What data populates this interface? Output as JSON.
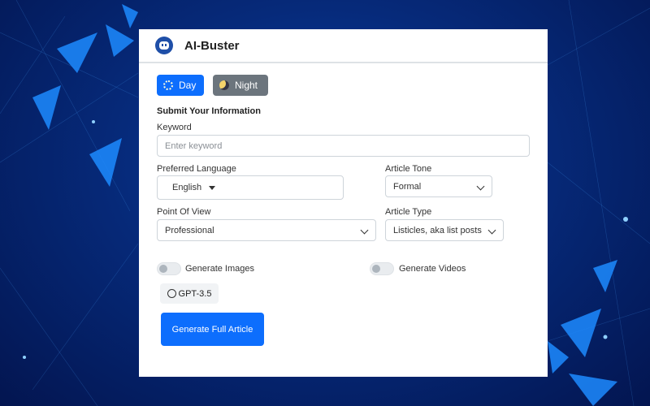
{
  "app": {
    "title": "AI-Buster"
  },
  "theme": {
    "day_label": "Day",
    "night_label": "Night"
  },
  "form": {
    "section_title": "Submit Your Information",
    "keyword": {
      "label": "Keyword",
      "placeholder": "Enter keyword"
    },
    "language": {
      "label": "Preferred Language",
      "value": "English"
    },
    "tone": {
      "label": "Article Tone",
      "value": "Formal"
    },
    "pov": {
      "label": "Point Of View",
      "value": "Professional"
    },
    "type": {
      "label": "Article Type",
      "value": "Listicles, aka list posts"
    },
    "toggles": {
      "images_label": "Generate Images",
      "videos_label": "Generate Videos",
      "images_on": false,
      "videos_on": false
    },
    "model": {
      "label": "GPT-3.5"
    },
    "submit_label": "Generate Full Article"
  },
  "colors": {
    "primary": "#0d6efd",
    "secondary": "#6c757d",
    "panel": "#ffffff"
  }
}
